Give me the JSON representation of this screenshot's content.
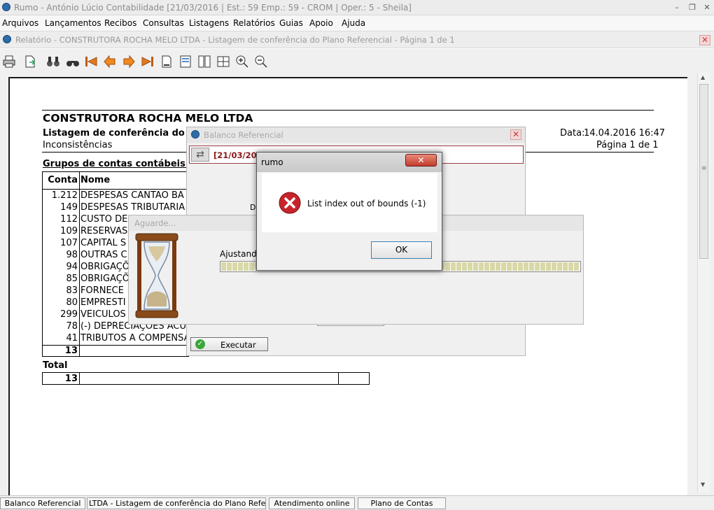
{
  "app": {
    "title": "Rumo - António Lúcio Contabilidade [21/03/2016 | Est.: 59 Emp.: 59 - CROM | Oper.: 5 - Sheila]"
  },
  "menu": [
    "Arquivos",
    "Lançamentos",
    "Recibos",
    "Consultas",
    "Listagens",
    "Relatórios",
    "Guias",
    "Apoio",
    "Ajuda"
  ],
  "child_window": {
    "title": "Relatório - CONSTRUTORA ROCHA MELO LTDA - Listagem de conferência do Plano Referencial - Página 1 de 1"
  },
  "toolbar_icons": [
    "printer-icon",
    "export-icon",
    "binoculars-icon",
    "binoculars-next-icon",
    "first-page-icon",
    "previous-page-icon",
    "next-page-icon",
    "last-page-icon",
    "page-width-icon",
    "full-page-icon",
    "two-pages-icon",
    "four-pages-icon",
    "zoom-in-icon",
    "zoom-out-icon"
  ],
  "report": {
    "company": "CONSTRUTORA ROCHA MELO LTDA",
    "subtitle": "Listagem de conferência do Plano",
    "section": "Inconsistências",
    "date_label": "Data:",
    "date_value": "14.04.2016  16:47",
    "page": "Página 1 de 1",
    "group_title": "Grupos de contas contábeis com",
    "col_conta": "Conta",
    "col_nome": "Nome",
    "rows": [
      {
        "conta": "1.212",
        "nome": "DESPESAS  CANTAO BA"
      },
      {
        "conta": "149",
        "nome": "DESPESAS TRIBUTARIA"
      },
      {
        "conta": "112",
        "nome": "CUSTO DE"
      },
      {
        "conta": "109",
        "nome": "RESERVAS"
      },
      {
        "conta": "107",
        "nome": "CAPITAL S"
      },
      {
        "conta": "98",
        "nome": "OUTRAS C"
      },
      {
        "conta": "94",
        "nome": "OBRIGAÇÕ"
      },
      {
        "conta": "85",
        "nome": "OBRIGAÇÕ"
      },
      {
        "conta": "83",
        "nome": "FORNECE"
      },
      {
        "conta": "80",
        "nome": "EMPRESTI"
      },
      {
        "conta": "299",
        "nome": "VEICULOS"
      },
      {
        "conta": "78",
        "nome": "(-) DEPRECIAÇÕES ACU"
      },
      {
        "conta": "41",
        "nome": "TRIBUTOS A COMPENSA"
      }
    ],
    "group_count": "13",
    "total_label": "Total",
    "total_count": "13"
  },
  "balanco_dialog": {
    "title": "Balanco Referencial",
    "header_text": "[21/03/2016] (59/59) CROM",
    "partial_label": "D",
    "execute_label": "Executar"
  },
  "aguarde_dialog": {
    "title": "Aguarde...",
    "status": "Ajustando",
    "progress": 1.0
  },
  "error_dialog": {
    "title": "rumo",
    "message": "List index out of bounds (-1)",
    "ok_label": "OK"
  },
  "taskbar": [
    "Balanco Referencial",
    "LTDA - Listagem de conferência do Plano Referencial - Página 1 de 1",
    "Atendimento online",
    "Plano de Contas"
  ],
  "colors": {
    "close_red": "#c43c3c",
    "progress_fill": "#d8d8a8",
    "error_icon": "#c8232c"
  }
}
